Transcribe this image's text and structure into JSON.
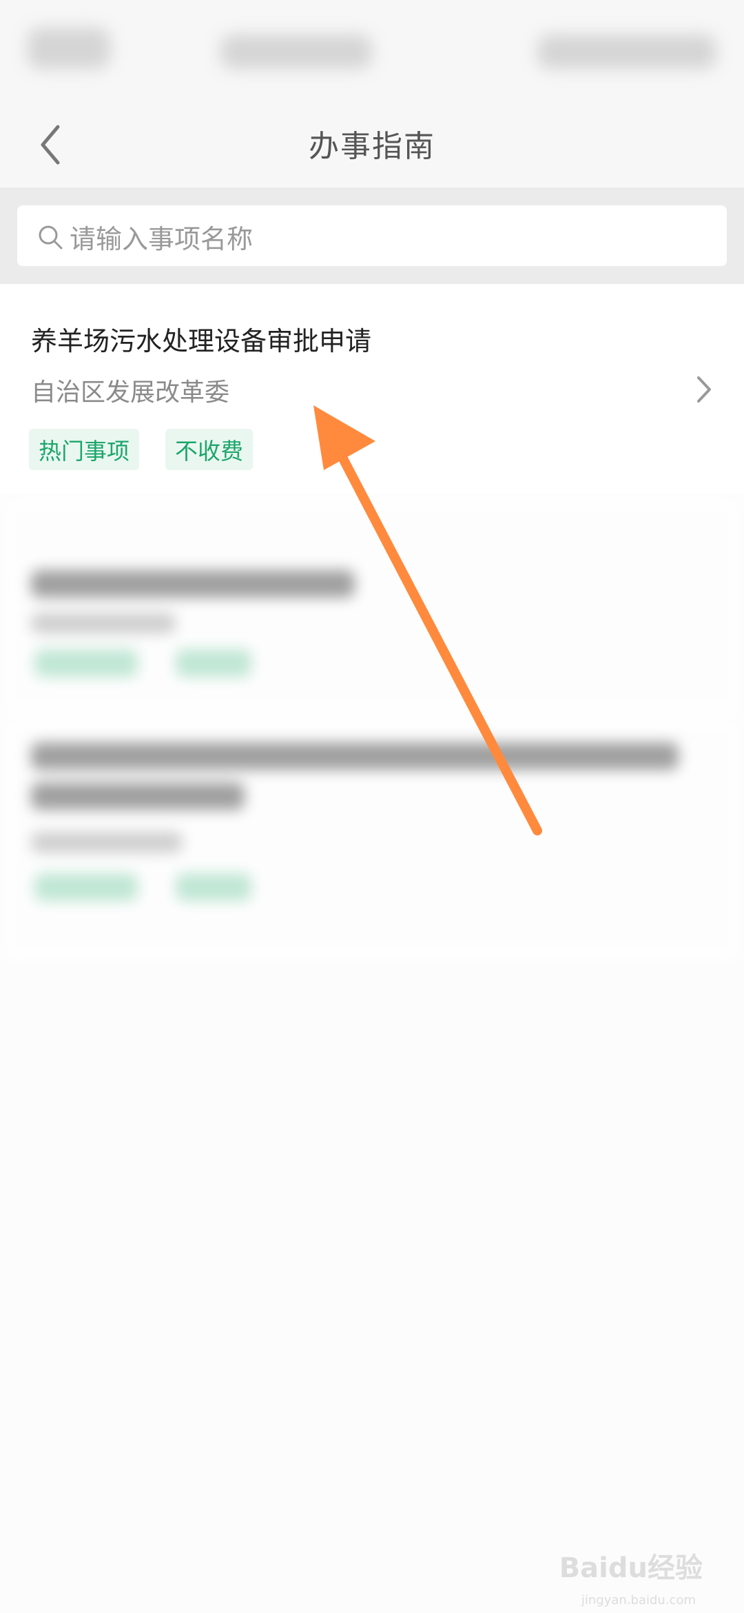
{
  "header": {
    "title": "办事指南"
  },
  "search": {
    "placeholder": "请输入事项名称"
  },
  "items": [
    {
      "title": "养羊场污水处理设备审批申请",
      "department": "自治区发展改革委",
      "tags": [
        "热门事项",
        "不收费"
      ]
    }
  ],
  "watermark": {
    "brand": "Baidu经验",
    "url": "jingyan.baidu.com"
  },
  "colors": {
    "tag_green": "#1ca66a",
    "tag_bg": "#eaf7f1",
    "arrow": "#ff8a3d"
  }
}
